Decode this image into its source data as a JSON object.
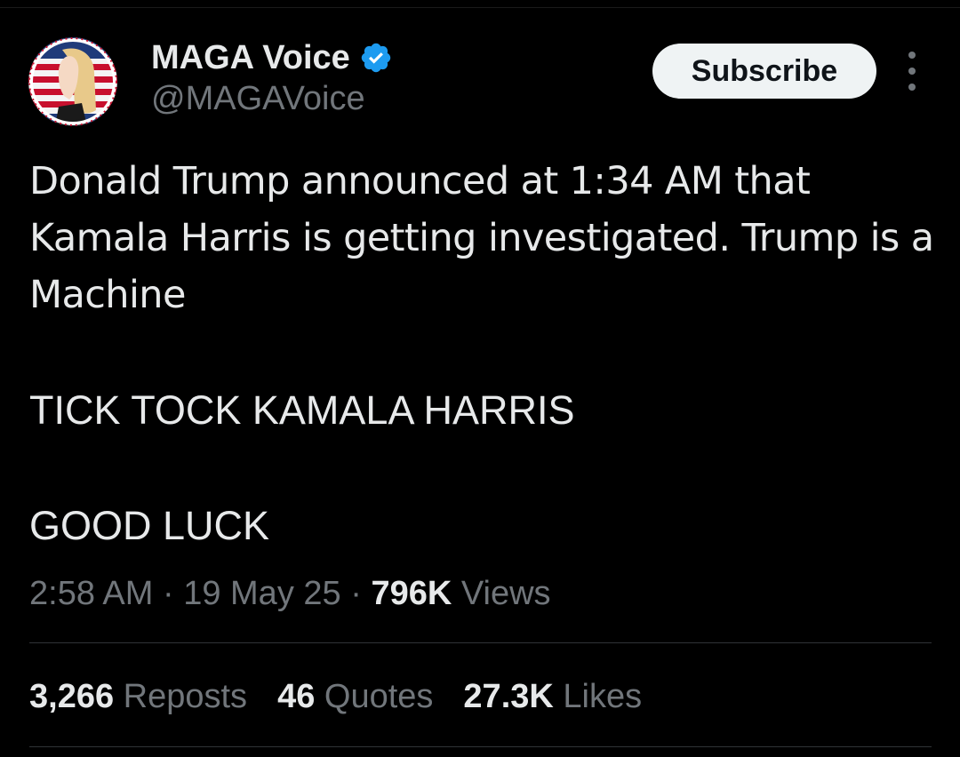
{
  "author": {
    "display_name": "MAGA Voice",
    "handle": "@MAGAVoice",
    "verified": true
  },
  "actions": {
    "subscribe_label": "Subscribe",
    "more_icon": "more-vertical-icon"
  },
  "tweet": {
    "text_paragraph": "Donald Trump announced at 1:34 AM that Kamala Harris is getting investigated. Trump is a Machine",
    "text_line2": "TICK TOCK KAMALA HARRIS",
    "text_line3": "GOOD LUCK"
  },
  "meta": {
    "time": "2:58 AM",
    "sep1": " · ",
    "date": "19 May 25",
    "sep2": " · ",
    "views_count": "796K",
    "views_label": " Views"
  },
  "stats": {
    "reposts_count": "3,266",
    "reposts_label": " Reposts",
    "quotes_count": "46",
    "quotes_label": " Quotes",
    "likes_count": "27.3K",
    "likes_label": " Likes"
  },
  "colors": {
    "background": "#000000",
    "primary_text": "#e7e9ea",
    "secondary_text": "#71767b",
    "verified_blue": "#1d9bf0",
    "divider": "#2f3336",
    "button_bg": "#eff3f4"
  }
}
